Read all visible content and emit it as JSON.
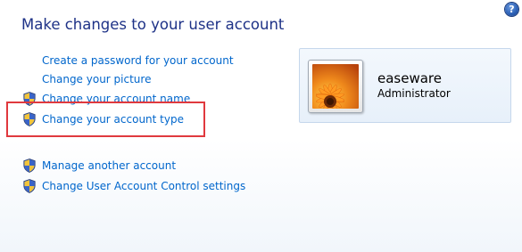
{
  "page": {
    "title": "Make changes to your user account",
    "help_label": "?"
  },
  "tasks": [
    {
      "label": "Create a password for your account",
      "shield": false
    },
    {
      "label": "Change your picture",
      "shield": false
    },
    {
      "label": "Change your account name",
      "shield": true
    },
    {
      "label": "Change your account type",
      "shield": true,
      "highlighted": true
    },
    {
      "label": "Manage another account",
      "shield": true
    },
    {
      "label": "Change User Account Control settings",
      "shield": true
    }
  ],
  "account": {
    "username": "easeware",
    "type": "Administrator",
    "picture": "orange-flower-avatar"
  },
  "colors": {
    "title": "#1e3287",
    "link": "#0066cc",
    "highlight_border": "#e0393e",
    "panel_bg": "#e7f0fa"
  },
  "icons": {
    "shield": "uac-shield-icon",
    "help": "help-icon"
  }
}
